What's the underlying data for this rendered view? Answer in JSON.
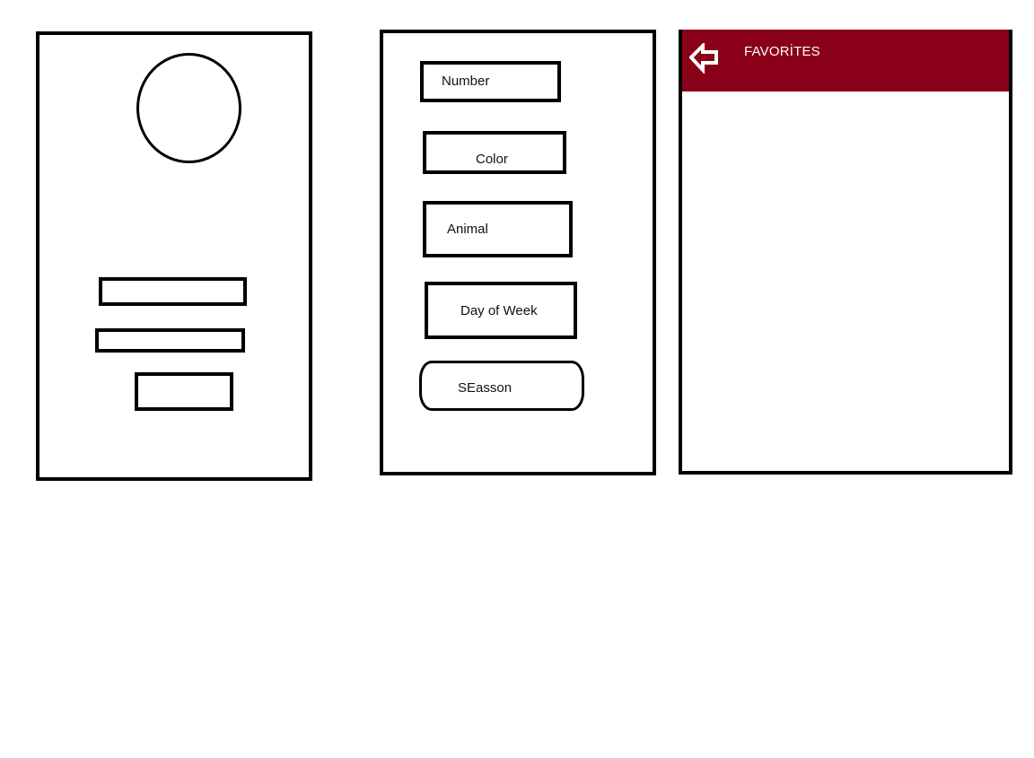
{
  "screen_login": {
    "avatar_icon": "user-avatar-circle"
  },
  "screen_categories": {
    "items": [
      {
        "label": "Number"
      },
      {
        "label": "Color"
      },
      {
        "label": "Animal"
      },
      {
        "label": "Day of Week"
      },
      {
        "label": "SEasson"
      }
    ]
  },
  "screen_favorites": {
    "header": {
      "title": "FAVORİTES",
      "background_color": "#8a0018",
      "back_icon": "arrow-left-outline-icon"
    }
  }
}
